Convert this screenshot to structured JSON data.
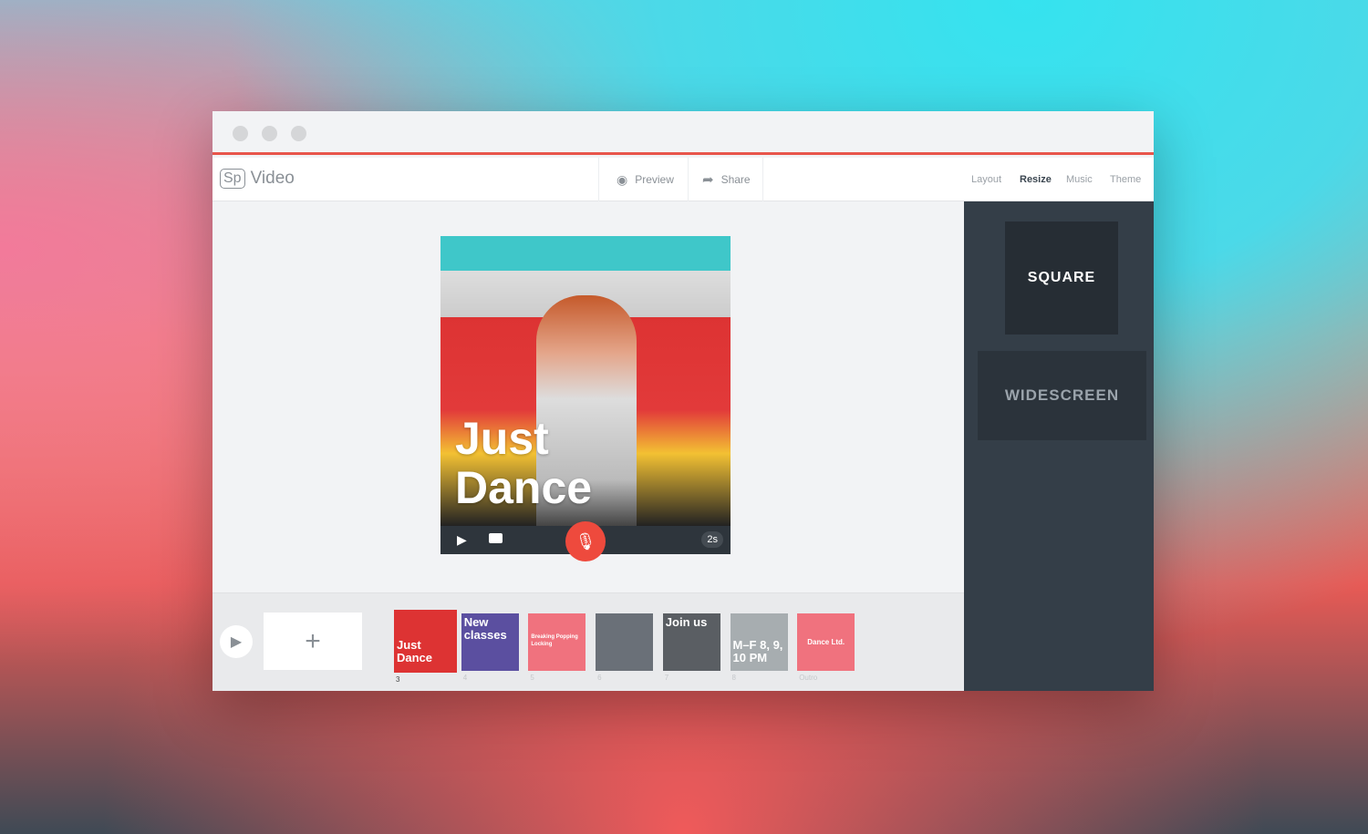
{
  "window": {
    "app_name": "Video",
    "logo": "Sp"
  },
  "toolbar": {
    "preview": "Preview",
    "share": "Share",
    "tabs": [
      "Layout",
      "Resize",
      "Music",
      "Theme"
    ],
    "active_tab": "Resize"
  },
  "resize_options": [
    "SQUARE",
    "WIDESCREEN"
  ],
  "canvas": {
    "headline_line1": "Just",
    "headline_line2": "Dance",
    "duration": "2s"
  },
  "timeline": {
    "add": "+",
    "slides": [
      {
        "num": "3",
        "text": "Just Dance",
        "bg": "#d33"
      },
      {
        "num": "4",
        "text": "New classes",
        "bg": "#5b4fa0"
      },
      {
        "num": "5",
        "text": "Breaking Popping Locking",
        "bg": "#f0727e"
      },
      {
        "num": "6",
        "text": "",
        "bg": "#6a7078"
      },
      {
        "num": "7",
        "text": "Join us",
        "bg": "#5a5e63"
      },
      {
        "num": "8",
        "text": "M–F 8, 9, 10 PM",
        "bg": "#a7adb0"
      },
      {
        "num": "Outro",
        "text": "Dance Ltd.",
        "bg": "#f0727e"
      }
    ]
  },
  "colors": {
    "accent": "#e8554b",
    "sidebar": "#343e48",
    "mic": "#ee4a3d"
  }
}
